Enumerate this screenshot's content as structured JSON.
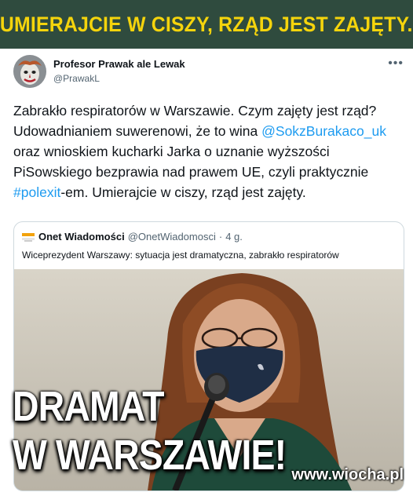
{
  "banner": {
    "text": "UMIERAJCIE W CISZY, RZĄD JEST ZAJĘTY."
  },
  "tweet": {
    "author_name": "Profesor Prawak ale Lewak",
    "author_handle": "@PrawakL",
    "more_icon": "more-dots-icon",
    "body": {
      "part1": "Zabrakło respiratorów w Warszawie. Czym zajęty jest rząd? Udowadnianiem suwerenowi, że to wina ",
      "mention": "@SokzBurakaco_uk",
      "part2": " oraz wnioskiem kucharki Jarka o uznanie wyższości PiSowskiego bezprawia nad prawem UE, czyli praktycznie ",
      "hashtag": "#polexit",
      "part3": "-em. Umierajcie w ciszy, rząd jest zajęty."
    },
    "mention_color": "#1d9bf0"
  },
  "quote": {
    "source_name": "Onet Wiadomości",
    "source_handle": "@OnetWiadomosci",
    "separator": "·",
    "time": "4 g.",
    "text": "Wiceprezydent Warszawy: sytuacja jest dramatyczna, zabrakło respiratorów",
    "logo_icon": "onet-logo-icon"
  },
  "overlay": {
    "line1": "DRAMAT",
    "line2": "W WARSZAWIE!"
  },
  "watermark": "www.wiocha.pl",
  "colors": {
    "banner_bg": "#2f4b3e",
    "banner_text": "#f5d40c",
    "link": "#1d9bf0"
  }
}
